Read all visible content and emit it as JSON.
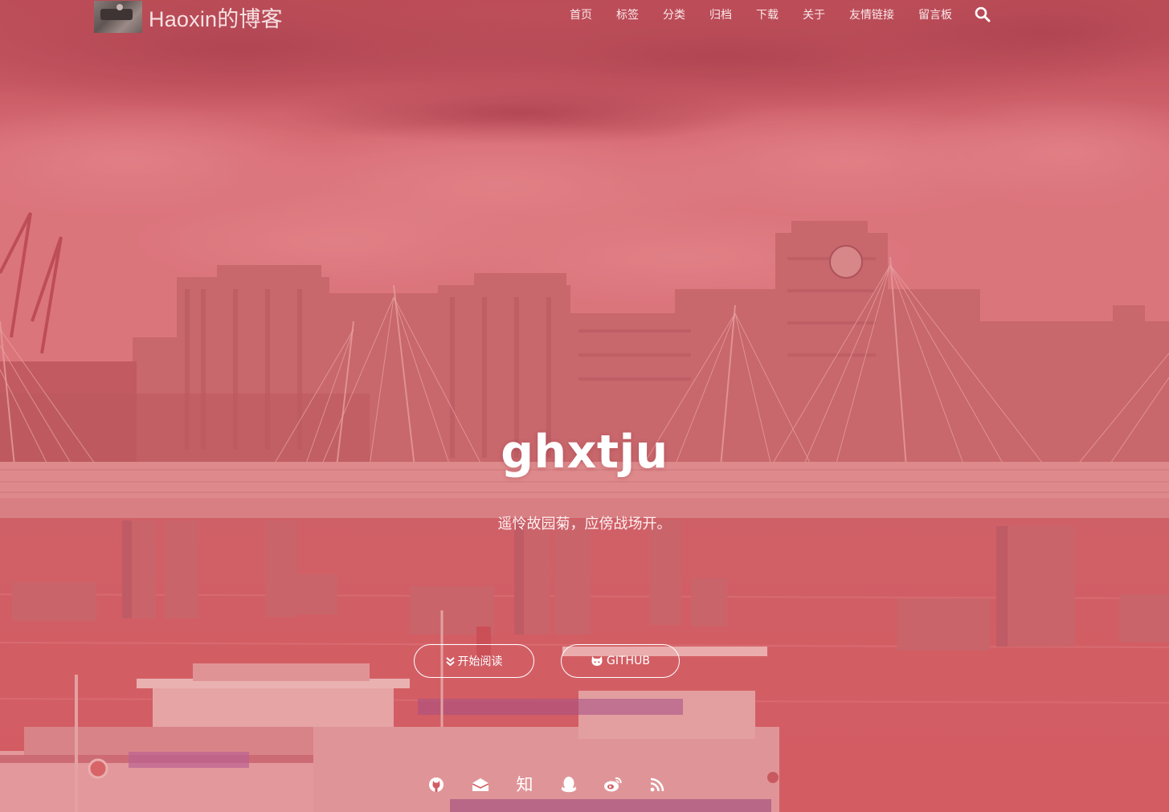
{
  "site": {
    "brand_name": "Haoxin的博客",
    "title": "ghxtju",
    "subtitle": "遥怜故园菊，应傍战场开。"
  },
  "nav": {
    "items": [
      {
        "label": "首页"
      },
      {
        "label": "标签"
      },
      {
        "label": "分类"
      },
      {
        "label": "归档"
      },
      {
        "label": "下载"
      },
      {
        "label": "关于"
      },
      {
        "label": "友情链接"
      },
      {
        "label": "留言板"
      }
    ],
    "search_icon": "search-icon"
  },
  "buttons": {
    "read_label": "开始阅读",
    "read_icon": "double-chevron-down-icon",
    "github_label": "GITHUB",
    "github_icon": "github-cat-icon"
  },
  "socials": [
    {
      "name": "github-icon"
    },
    {
      "name": "email-icon"
    },
    {
      "name": "zhihu-icon",
      "text": "知"
    },
    {
      "name": "qq-icon"
    },
    {
      "name": "weibo-icon"
    },
    {
      "name": "rss-icon"
    }
  ],
  "colors": {
    "overlay": "#d35f66",
    "text": "#ffffff"
  }
}
